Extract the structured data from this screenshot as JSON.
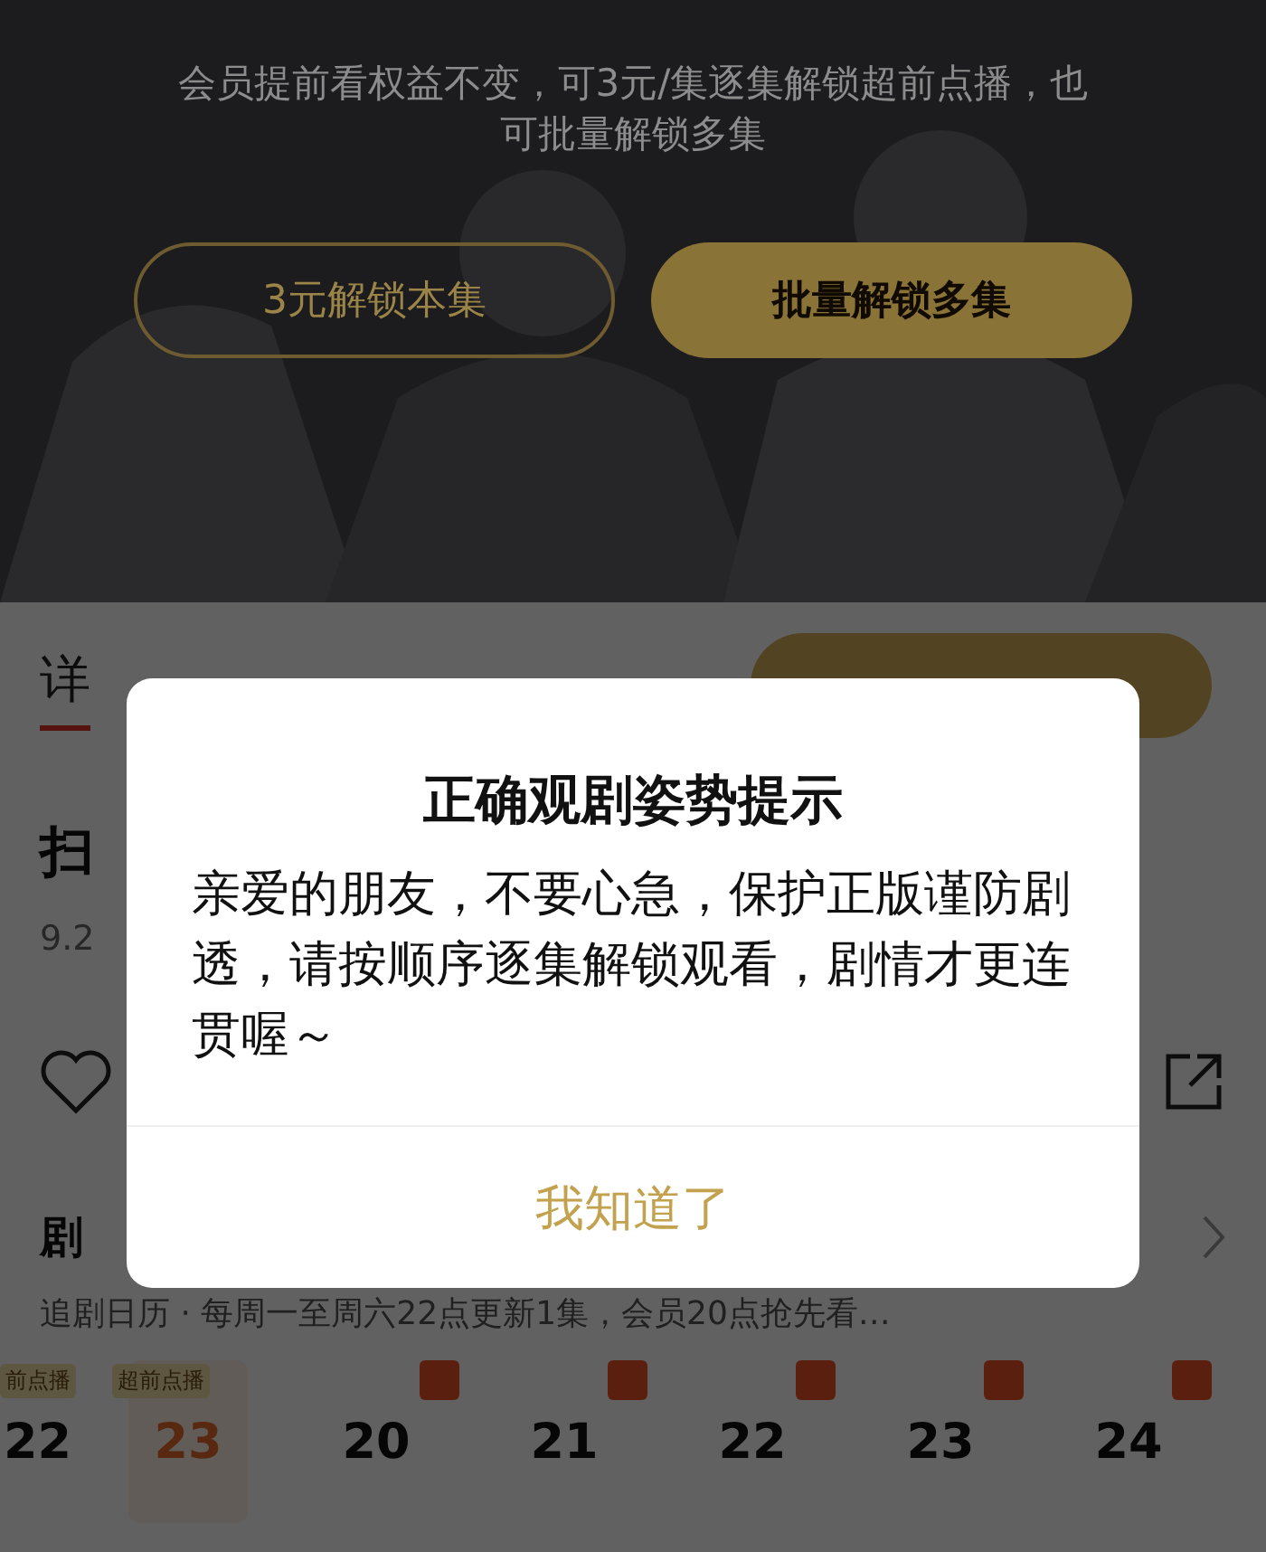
{
  "hero": {
    "notice": "会员提前看权益不变，可3元/集逐集解锁超前点播，也可批量解锁多集",
    "buttons": [
      {
        "label": "3元解锁本集",
        "kind": "outline"
      },
      {
        "label": "批量解锁多集",
        "kind": "filled"
      }
    ]
  },
  "tabs": [
    {
      "label": "详",
      "selected": true
    }
  ],
  "show": {
    "title": "扫",
    "rating": "9.2"
  },
  "episodes": {
    "heading": "剧",
    "schedule": "追剧日历 · 每周一至周六22点更新1集，会员20点抢先看…",
    "items": [
      {
        "number": "22",
        "kind": "advance",
        "tag": "前点播",
        "selected": false
      },
      {
        "number": "23",
        "kind": "advance",
        "tag": "超前点播",
        "selected": true
      },
      {
        "number": "20",
        "kind": "marked",
        "selected": false
      },
      {
        "number": "21",
        "kind": "marked",
        "selected": false
      },
      {
        "number": "22",
        "kind": "marked",
        "selected": false
      },
      {
        "number": "23",
        "kind": "marked",
        "selected": false
      },
      {
        "number": "24",
        "kind": "marked",
        "selected": false
      }
    ]
  },
  "dialog": {
    "title": "正确观剧姿势提示",
    "message": "亲爱的朋友，不要心急，保护正版谨防剧透，请按顺序逐集解锁观看，剧情才更连贯喔～",
    "button": "我知道了"
  }
}
